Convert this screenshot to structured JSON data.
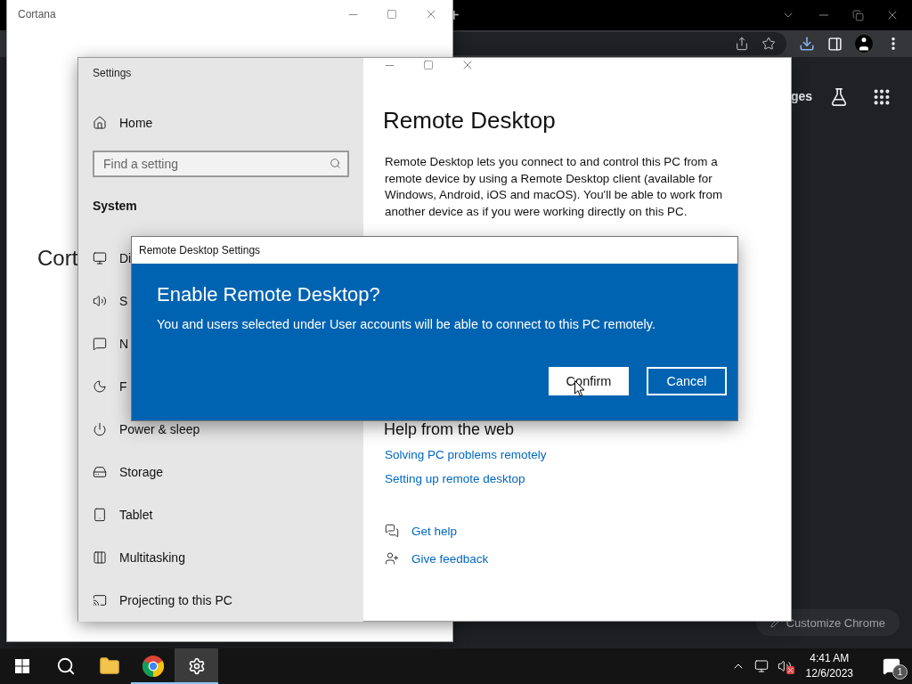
{
  "chrome": {
    "new_tab": "+",
    "partial_link": "ges",
    "customize_button": "Customize Chrome"
  },
  "cortana": {
    "title": "Cortana",
    "heading": "Cort"
  },
  "settings": {
    "title": "Settings",
    "home": "Home",
    "search": {
      "placeholder": "Find a setting"
    },
    "section": "System",
    "nav": [
      {
        "label": "Di",
        "kind": "display"
      },
      {
        "label": "S",
        "kind": "sound"
      },
      {
        "label": "N",
        "kind": "notifications"
      },
      {
        "label": "F",
        "kind": "focus"
      },
      {
        "label": "Power & sleep",
        "kind": "power"
      },
      {
        "label": "Storage",
        "kind": "storage"
      },
      {
        "label": "Tablet",
        "kind": "tablet"
      },
      {
        "label": "Multitasking",
        "kind": "multitasking"
      },
      {
        "label": "Projecting to this PC",
        "kind": "projecting"
      }
    ],
    "page_title": "Remote Desktop",
    "description": "Remote Desktop lets you connect to and control this PC from a remote device by using a Remote Desktop client (available for Windows, Android, iOS and macOS). You'll be able to work from another device as if you were working directly on this PC.",
    "help_title": "Help from the web",
    "links": [
      "Solving PC problems remotely",
      "Setting up remote desktop"
    ],
    "support": [
      {
        "label": "Get help",
        "kind": "help"
      },
      {
        "label": "Give feedback",
        "kind": "feedback"
      }
    ]
  },
  "dialog": {
    "title": "Remote Desktop Settings",
    "heading": "Enable Remote Desktop?",
    "message": "You and users selected under User accounts will be able to connect to this PC remotely.",
    "buttons": [
      {
        "label": "Confirm",
        "kind": "primary"
      },
      {
        "label": "Cancel",
        "kind": "secondary"
      }
    ]
  },
  "taskbar": {
    "apps": [
      {
        "kind": "start",
        "selected": false,
        "running": false
      },
      {
        "kind": "search",
        "selected": false,
        "running": false
      },
      {
        "kind": "explorer",
        "selected": false,
        "running": false
      },
      {
        "kind": "chrome",
        "selected": false,
        "running": true
      },
      {
        "kind": "settings",
        "selected": true,
        "running": true
      }
    ],
    "time": "4:41 AM",
    "date": "12/6/2023",
    "notifications": "1"
  }
}
